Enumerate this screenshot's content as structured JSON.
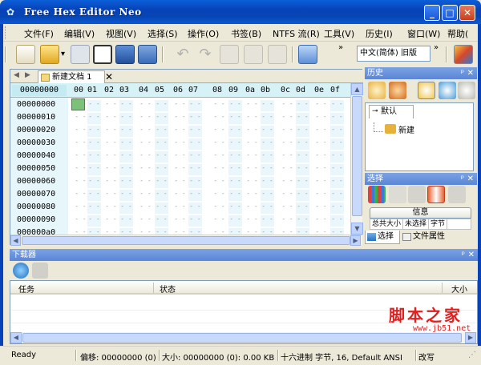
{
  "window": {
    "title": "Free Hex Editor Neo"
  },
  "menu": [
    "文件(F)",
    "编辑(V)",
    "视图(V)",
    "选择(S)",
    "操作(O)",
    "书签(B)",
    "NTFS 流(R)",
    "工具(V)",
    "历史(I)",
    "窗口(W)",
    "帮助("
  ],
  "toolbar": {
    "encoding_value": "中文(简体) 旧版",
    "overflow": "»"
  },
  "editor": {
    "tab_label": "新建文档 1",
    "address_header": "00000000",
    "column_headers": [
      "00",
      "01",
      "02",
      "03",
      "04",
      "05",
      "06",
      "07",
      "08",
      "09",
      "0a",
      "0b",
      "0c",
      "0d",
      "0e",
      "0f"
    ],
    "addresses": [
      "00000000",
      "00000010",
      "00000020",
      "00000030",
      "00000040",
      "00000050",
      "00000060",
      "00000070",
      "00000080",
      "00000090",
      "000000a0"
    ],
    "empty_byte": "- -"
  },
  "history_panel": {
    "title": "历史",
    "tree_tab": "默认",
    "tree_node": "新建"
  },
  "selection_panel": {
    "title": "选择",
    "info_tab": "信息",
    "info_columns": [
      "总共大小",
      "未选择",
      "字节"
    ],
    "tabs": [
      "选择",
      "文件属性"
    ]
  },
  "download_panel": {
    "title": "下载器",
    "columns": [
      "任务",
      "状态",
      "大小"
    ]
  },
  "watermark": {
    "text": "脚本之家",
    "url": "www.jb51.net"
  },
  "status_bar": {
    "state": "Ready",
    "offset": "偏移: 00000000 (0)",
    "size": "大小: 00000000 (0): 0.00 KB",
    "format": "十六进制 字节, 16, Default ANSI",
    "mode": "改写"
  },
  "colors": {
    "title_bar": "#0842b8",
    "panel_title": "#6a92dc",
    "cursor": "#7cc07a",
    "header_bg": "#d7f2f7",
    "watermark": "#e02020"
  }
}
